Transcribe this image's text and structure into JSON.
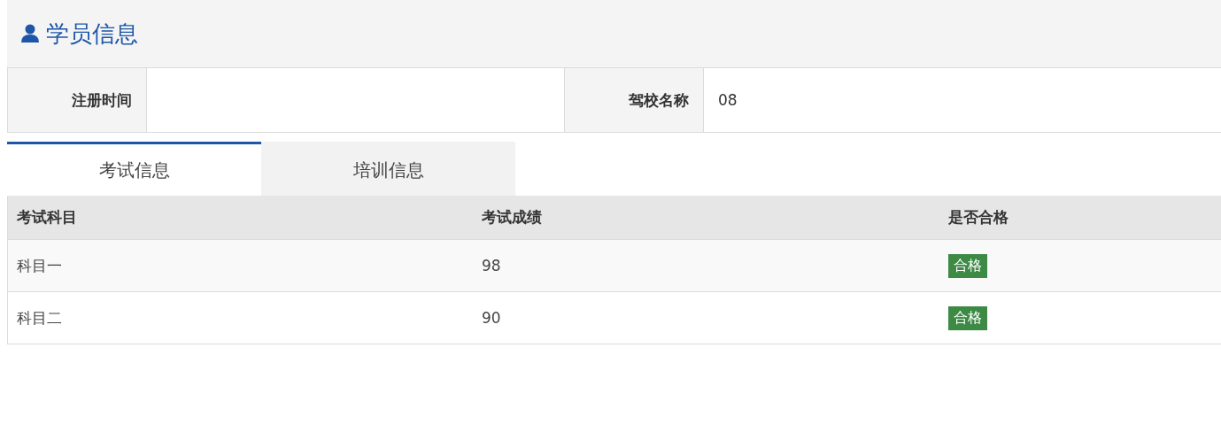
{
  "header": {
    "title": "学员信息"
  },
  "info_fields": [
    {
      "label": "注册时间"
    },
    {
      "label": "驾校名称",
      "value": "08"
    }
  ],
  "tabs": [
    {
      "label": "考试信息",
      "selected": true
    },
    {
      "label": "培训信息",
      "selected": false
    }
  ],
  "table": {
    "columns": [
      "考试科目",
      "考试成绩",
      "是否合格"
    ],
    "rows": [
      {
        "subject": "科目一",
        "score": "98",
        "result": {
          "label": "合格",
          "kind": "pass"
        }
      },
      {
        "subject": "科目二",
        "score": "90",
        "result": {
          "label": "合格",
          "kind": "pass"
        }
      }
    ]
  }
}
